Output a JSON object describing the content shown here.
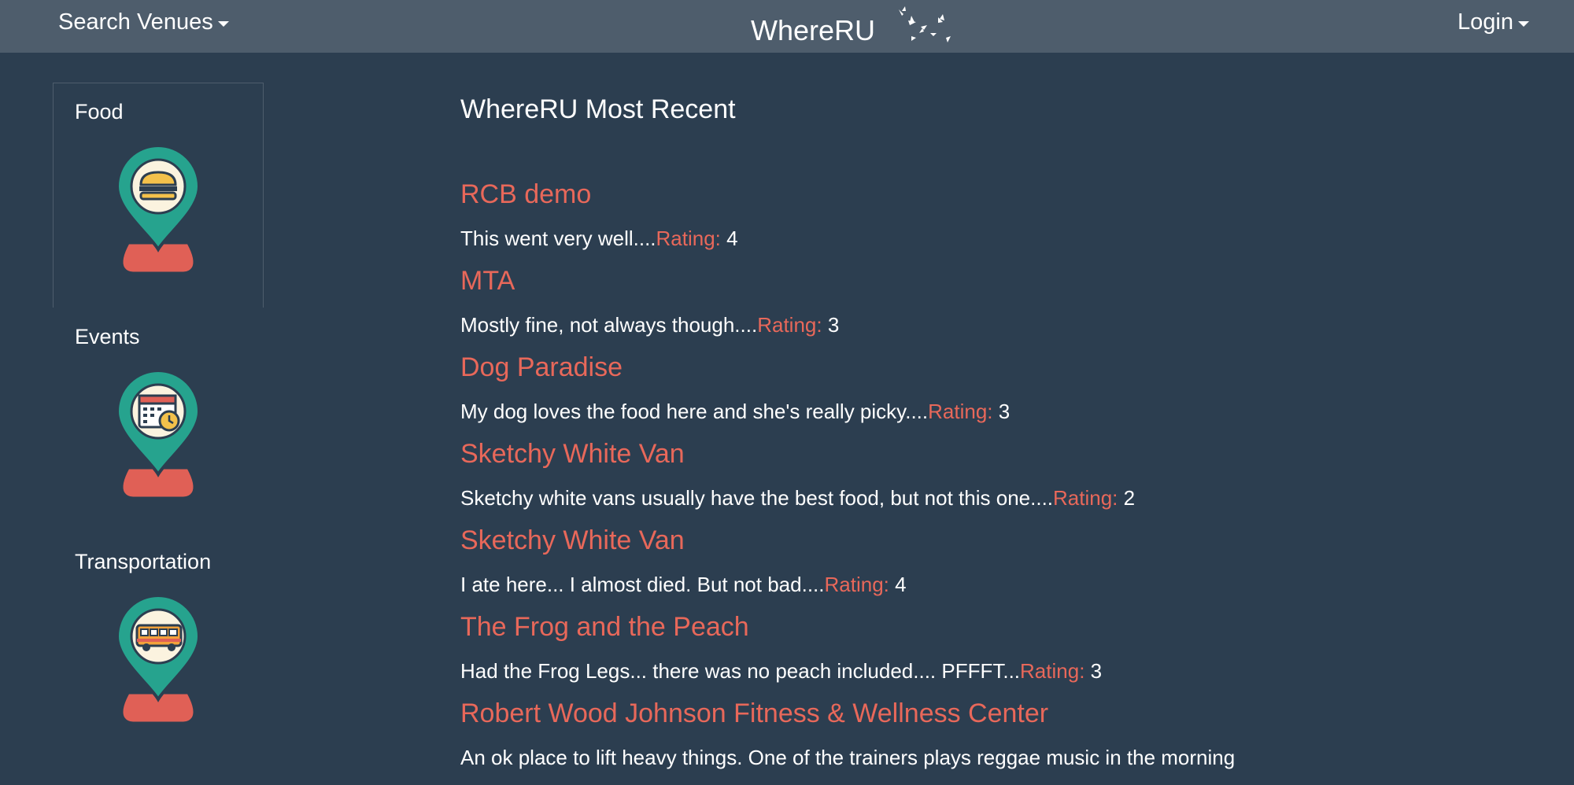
{
  "navbar": {
    "search_label": "Search Venues",
    "brand": "WhereRU",
    "login_label": "Login"
  },
  "colors": {
    "background": "#2c3e50",
    "navbar": "#4e5d6c",
    "accent": "#e8685a",
    "pin_teal": "#26a38e",
    "pin_base": "#e06056"
  },
  "sidebar": {
    "categories": [
      {
        "label": "Food",
        "icon": "hamburger-pin-icon"
      },
      {
        "label": "Events",
        "icon": "calendar-pin-icon"
      },
      {
        "label": "Transportation",
        "icon": "bus-pin-icon"
      }
    ]
  },
  "main": {
    "title": "WhereRU Most Recent",
    "rating_label": "Rating:",
    "reviews": [
      {
        "venue": "RCB demo",
        "text": "This went very well....",
        "rating": "4"
      },
      {
        "venue": "MTA",
        "text": "Mostly fine, not always though....",
        "rating": "3"
      },
      {
        "venue": "Dog Paradise",
        "text": "My dog loves the food here and she's really picky....",
        "rating": "3"
      },
      {
        "venue": "Sketchy White Van",
        "text": "Sketchy white vans usually have the best food, but not this one....",
        "rating": "2"
      },
      {
        "venue": "Sketchy White Van",
        "text": "I ate here... I almost died. But not bad....",
        "rating": "4"
      },
      {
        "venue": "The Frog and the Peach",
        "text": "Had the Frog Legs... there was no peach included.... PFFFT...",
        "rating": "3"
      },
      {
        "venue": "Robert Wood Johnson Fitness & Wellness Center",
        "text": "An ok place to lift heavy things. One of the trainers plays reggae music in the morning",
        "rating": ""
      }
    ]
  }
}
